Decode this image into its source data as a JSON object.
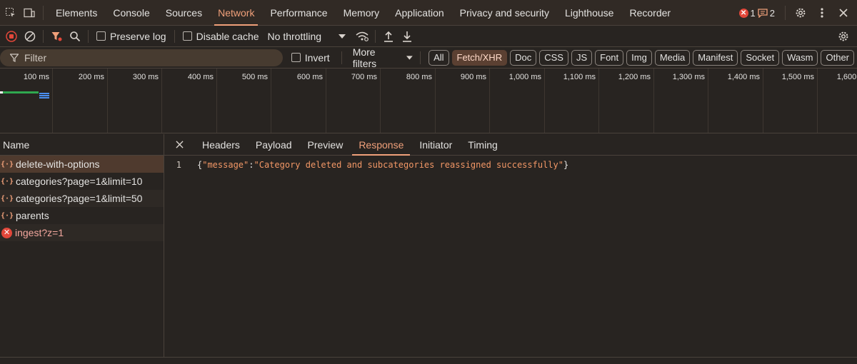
{
  "tabs": [
    {
      "label": "Elements"
    },
    {
      "label": "Console"
    },
    {
      "label": "Sources"
    },
    {
      "label": "Network"
    },
    {
      "label": "Performance"
    },
    {
      "label": "Memory"
    },
    {
      "label": "Application"
    },
    {
      "label": "Privacy and security"
    },
    {
      "label": "Lighthouse"
    },
    {
      "label": "Recorder"
    }
  ],
  "active_tab": "Network",
  "counters": {
    "errors": "1",
    "messages": "2"
  },
  "toolbar": {
    "preserve_log": "Preserve log",
    "disable_cache": "Disable cache",
    "throttling": "No throttling"
  },
  "filter": {
    "placeholder": "Filter",
    "invert": "Invert",
    "more_filters": "More filters",
    "types": [
      "All",
      "Fetch/XHR",
      "Doc",
      "CSS",
      "JS",
      "Font",
      "Img",
      "Media",
      "Manifest",
      "Socket",
      "Wasm",
      "Other"
    ],
    "active_type": "Fetch/XHR"
  },
  "timeline": {
    "ticks": [
      "100 ms",
      "200 ms",
      "300 ms",
      "400 ms",
      "500 ms",
      "600 ms",
      "700 ms",
      "800 ms",
      "900 ms",
      "1,000 ms",
      "1,100 ms",
      "1,200 ms",
      "1,300 ms",
      "1,400 ms",
      "1,500 ms",
      "1,600 ms"
    ]
  },
  "requests": {
    "header": "Name",
    "items": [
      {
        "name": "delete-with-options",
        "type": "xhr"
      },
      {
        "name": "categories?page=1&limit=10",
        "type": "xhr"
      },
      {
        "name": "categories?page=1&limit=50",
        "type": "xhr"
      },
      {
        "name": "parents",
        "type": "xhr"
      },
      {
        "name": "ingest?z=1",
        "type": "error"
      }
    ]
  },
  "detail": {
    "tabs": [
      "Headers",
      "Payload",
      "Preview",
      "Response",
      "Initiator",
      "Timing"
    ],
    "active_tab": "Response",
    "response": {
      "line_number": "1",
      "key": "\"message\"",
      "value": "\"Category deleted and subcategories reassigned successfully\""
    }
  },
  "colors": {
    "accent": "#f0a07a",
    "error": "#e2473a",
    "background": "#282421",
    "selected_row": "#4f3a2e"
  }
}
